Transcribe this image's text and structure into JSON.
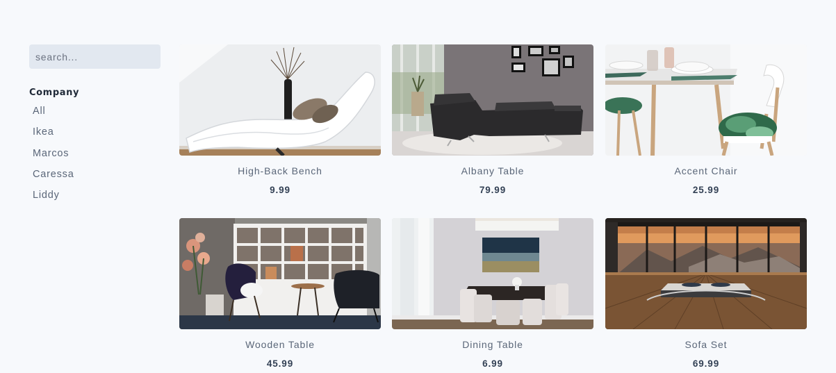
{
  "search": {
    "placeholder": "search..."
  },
  "filters": {
    "heading": "Company",
    "companies": [
      "All",
      "Ikea",
      "Marcos",
      "Caressa",
      "Liddy"
    ]
  },
  "products": [
    {
      "title": "High-Back Bench",
      "price": "9.99",
      "image": "white-chaise-lounge-photo"
    },
    {
      "title": "Albany Table",
      "price": "79.99",
      "image": "dark-sectional-sofa-photo"
    },
    {
      "title": "Accent Chair",
      "price": "25.99",
      "image": "dining-setting-chair-photo"
    },
    {
      "title": "Wooden Table",
      "price": "45.99",
      "image": "shelving-lounge-room-photo"
    },
    {
      "title": "Dining Table",
      "price": "6.99",
      "image": "dining-room-photo"
    },
    {
      "title": "Sofa Set",
      "price": "69.99",
      "image": "mountain-view-bed-photo"
    }
  ]
}
